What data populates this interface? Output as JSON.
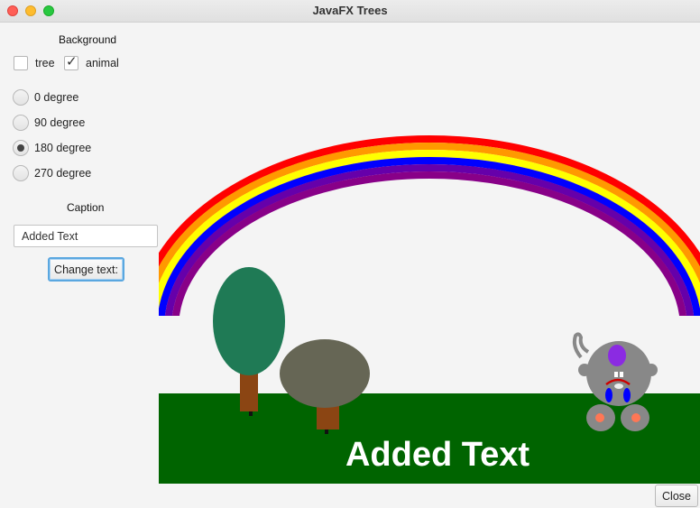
{
  "window": {
    "title": "JavaFX Trees"
  },
  "sidebar": {
    "background_heading": "Background",
    "checkboxes": [
      {
        "label": "tree",
        "checked": false
      },
      {
        "label": "animal",
        "checked": true
      }
    ],
    "rotation_options": [
      {
        "label": "0 degree",
        "selected": false
      },
      {
        "label": "90 degree",
        "selected": false
      },
      {
        "label": "180 degree",
        "selected": true
      },
      {
        "label": "270 degree",
        "selected": false
      }
    ],
    "caption_heading": "Caption",
    "caption_input_value": "Added Text",
    "change_text_button": "Change text:"
  },
  "scene": {
    "caption": "Added Text",
    "rainbow_colors": [
      "#ff0000",
      "#ff9900",
      "#ffff00",
      "#0000ff",
      "#6600aa",
      "#880088"
    ],
    "ground_color": "#006400",
    "tree_foliage_colors": [
      "#1f7a55",
      "#666655"
    ],
    "trunk_color": "#8b4513",
    "animal_color": "#888888"
  },
  "footer": {
    "close_button": "Close"
  }
}
